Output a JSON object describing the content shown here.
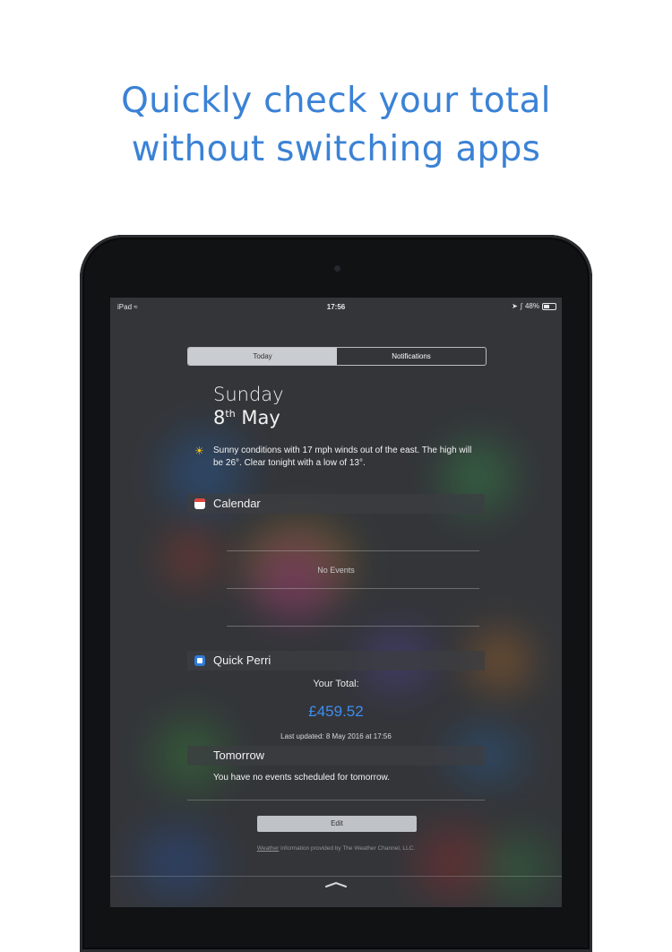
{
  "headline": {
    "line1": "Quickly check your total",
    "line2": "without switching apps"
  },
  "statusbar": {
    "carrier": "iPad",
    "time": "17:56",
    "battery": "48%"
  },
  "segments": {
    "today": "Today",
    "notifications": "Notifications"
  },
  "date": {
    "weekday": "Sunday",
    "day": "8",
    "suffix": "th",
    "month": "May"
  },
  "weather": {
    "text": "Sunny conditions with 17 mph winds out of the east. The high will be 26°. Clear tonight with a low of 13°."
  },
  "calendar": {
    "title": "Calendar",
    "empty": "No Events"
  },
  "quick_perri": {
    "title": "Quick Perri",
    "total_label": "Your Total:",
    "total_value": "£459.52",
    "last_updated": "Last updated: 8 May 2016 at 17:56"
  },
  "tomorrow": {
    "title": "Tomorrow",
    "text": "You have no events scheduled for tomorrow."
  },
  "edit_label": "Edit",
  "attribution": {
    "link": "Weather",
    "text": " information provided by The Weather Channel, LLC."
  },
  "colors": {
    "headline": "#3b82d6",
    "amount": "#3e8df0"
  }
}
